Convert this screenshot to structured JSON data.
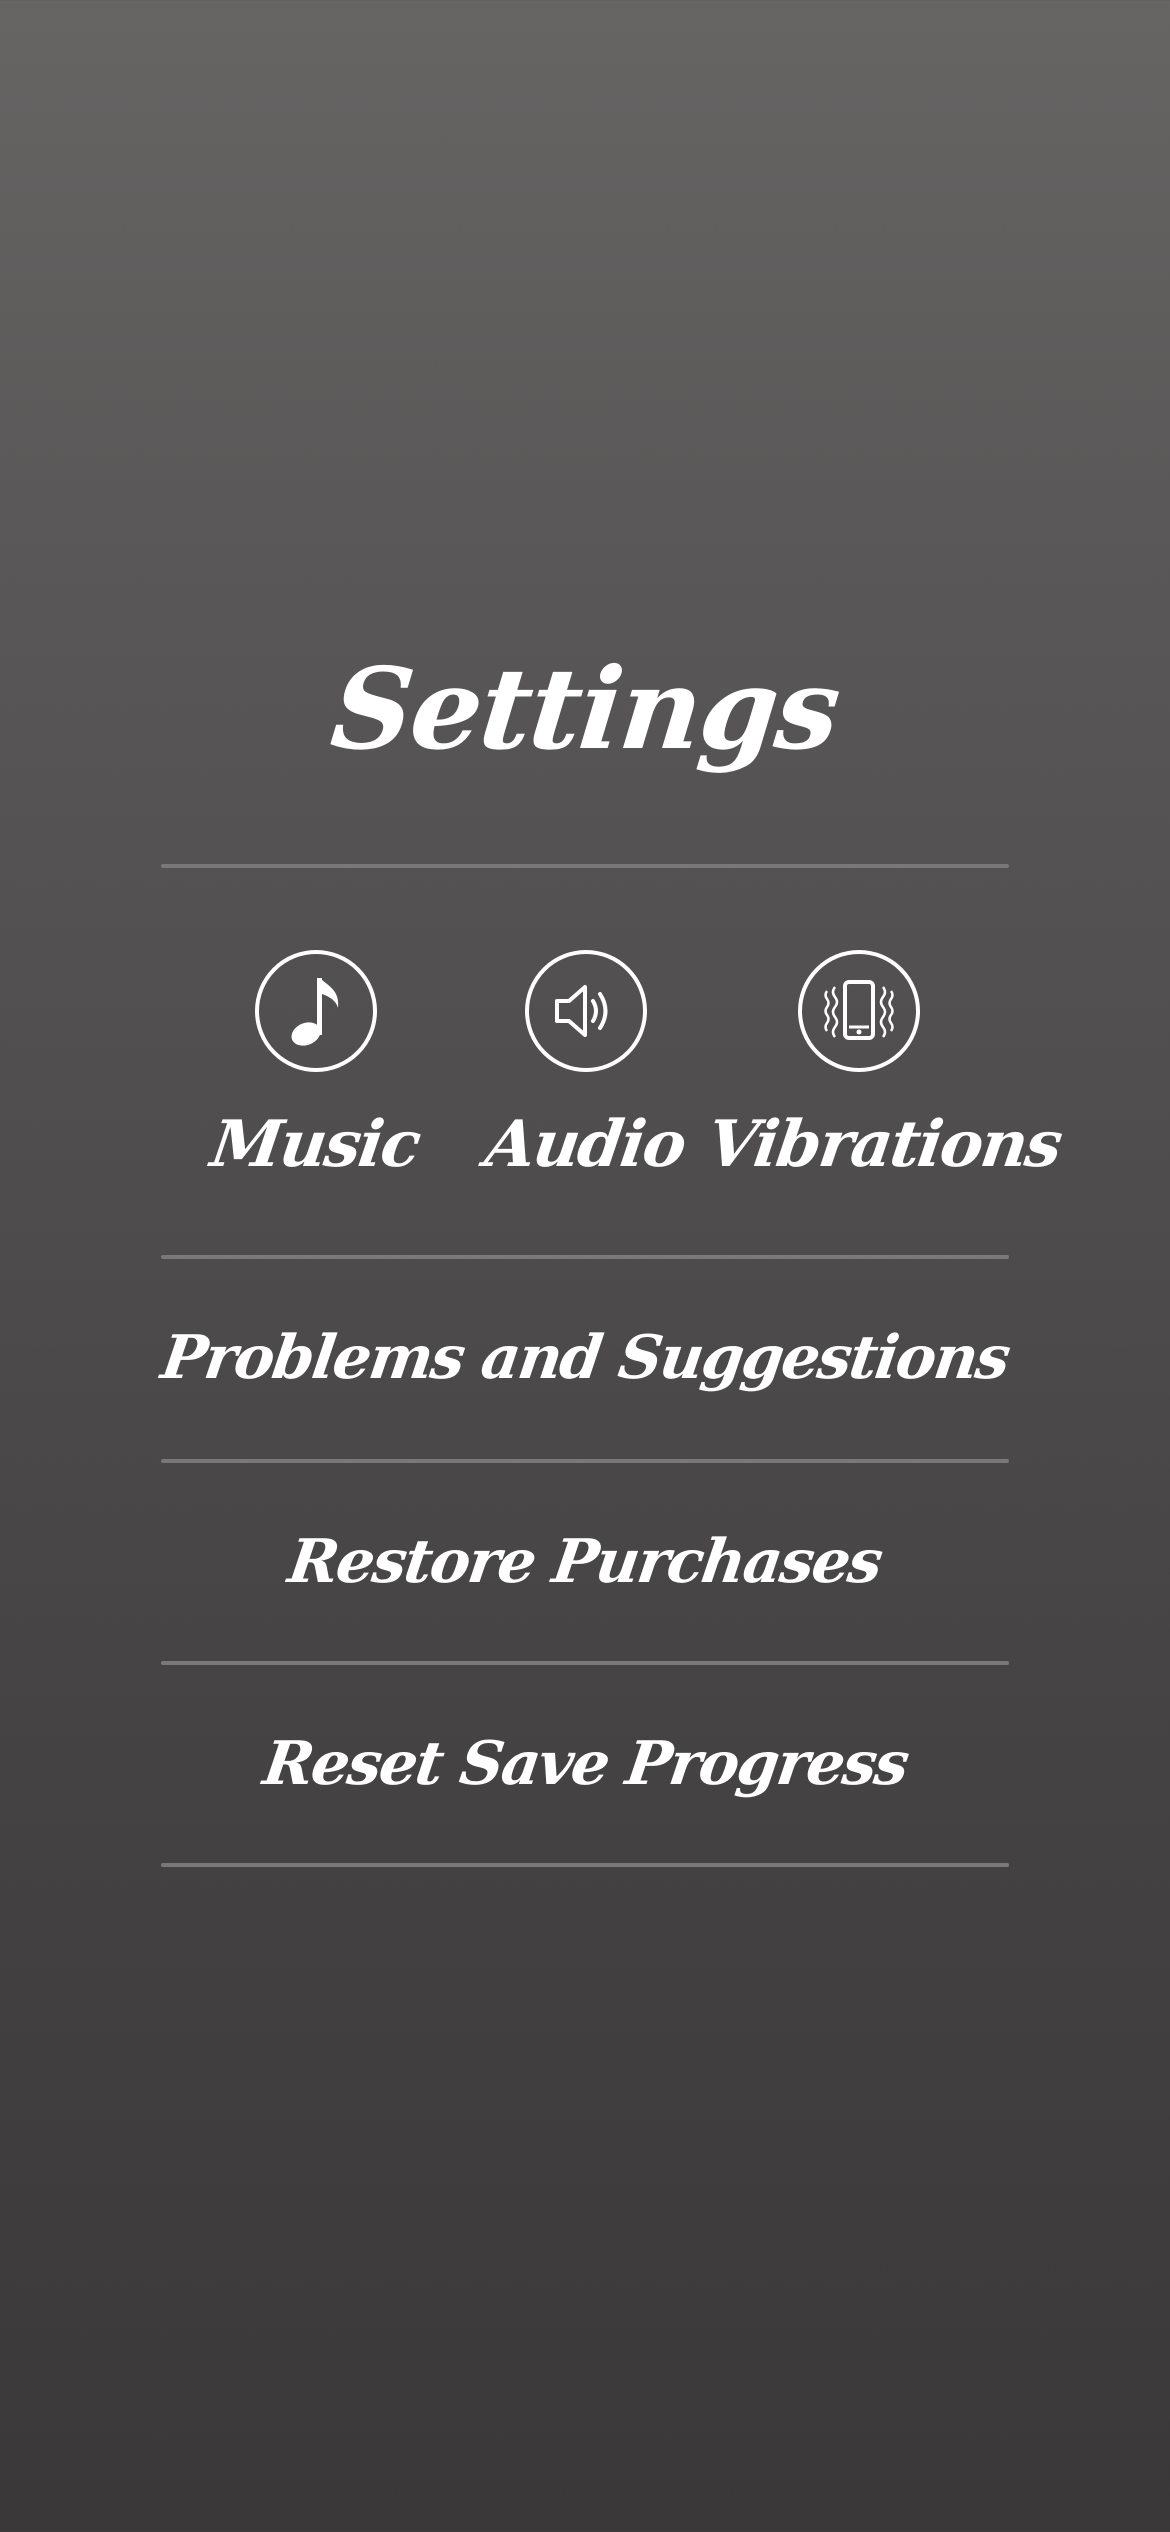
{
  "screen": {
    "title": "Settings"
  },
  "toggles": [
    {
      "label": "Music",
      "icon": "music-note-icon"
    },
    {
      "label": "Audio",
      "icon": "speaker-icon"
    },
    {
      "label": "Vibrations",
      "icon": "phone-vibrate-icon"
    }
  ],
  "menu": {
    "problems_label": "Problems and Suggestions",
    "restore_label": "Restore Purchases",
    "reset_label": "Reset Save Progress"
  },
  "colors": {
    "text": "#ffffff",
    "divider": "#7a7878",
    "background_top": "#666564",
    "background_bottom": "#3a3838"
  }
}
